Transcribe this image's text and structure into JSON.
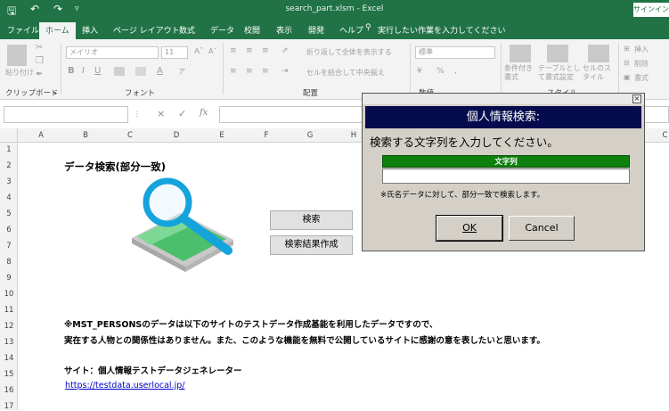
{
  "titlebar": {
    "title": "search_part.xlsm  -  Excel",
    "signin": "サインイン"
  },
  "tabs": [
    {
      "label": "ファイル"
    },
    {
      "label": "ホーム"
    },
    {
      "label": "挿入"
    },
    {
      "label": "ページ レイアウト"
    },
    {
      "label": "数式"
    },
    {
      "label": "データ"
    },
    {
      "label": "校閲"
    },
    {
      "label": "表示"
    },
    {
      "label": "開発"
    },
    {
      "label": "ヘルプ"
    }
  ],
  "tell_me": "実行したい作業を入力してください",
  "ribbon": {
    "paste": "貼り付け",
    "clipboard": "クリップボード",
    "font_name": "メイリオ",
    "font_size": "11",
    "font_group": "フォント",
    "wrap_text": "折り返して全体を表示する",
    "merge_center": "セルを結合して中央揃え",
    "alignment": "配置",
    "number_format": "標準",
    "number_group": "数値",
    "cond_format": "条件付き書式",
    "format_table": "テーブルとして書式設定",
    "cell_style": "セルのスタイル",
    "styles": "スタイル",
    "insert": "挿入",
    "delete": "削除",
    "format": "書式"
  },
  "formula_bar": {
    "fx": "fx",
    "cancel": "×",
    "enter": "✓"
  },
  "columns": [
    "A",
    "B",
    "C",
    "D",
    "E",
    "F",
    "G",
    "H",
    "",
    "",
    "",
    "",
    "",
    "",
    "C"
  ],
  "rows": [
    "1",
    "2",
    "3",
    "4",
    "5",
    "6",
    "7",
    "8",
    "9",
    "10",
    "11",
    "12",
    "13",
    "14",
    "15",
    "16",
    "17"
  ],
  "sheet": {
    "heading": "データ検索(部分一致)",
    "search_button": "検索",
    "result_button": "検索結果作成",
    "note_line1": "※MST_PERSONSのデータは以下のサイトのテストデータ作成基能を利用したデータですので、",
    "note_line2": "実在する人物との関係性はありません。また、このような機能を無料で公開しているサイトに感謝の意を表したいと思います。",
    "site_label": "サイト：個人情報テストデータジェネレーター",
    "site_url": "https://testdata.userlocal.jp/"
  },
  "dialog": {
    "close": "×",
    "title": "個人情報検索:",
    "prompt": "検索する文字列を入力してください。",
    "field_label": "文字列",
    "field_value": "",
    "note": "※氏名データに対して、部分一致で検索します。",
    "ok": "OK",
    "cancel": "Cancel"
  },
  "colors": {
    "excel_green": "#217346",
    "dialog_title_bg": "#040c4e",
    "field_label_bg": "#0d800d",
    "dialog_bg": "#d4d0c8",
    "link": "#0000cc"
  }
}
